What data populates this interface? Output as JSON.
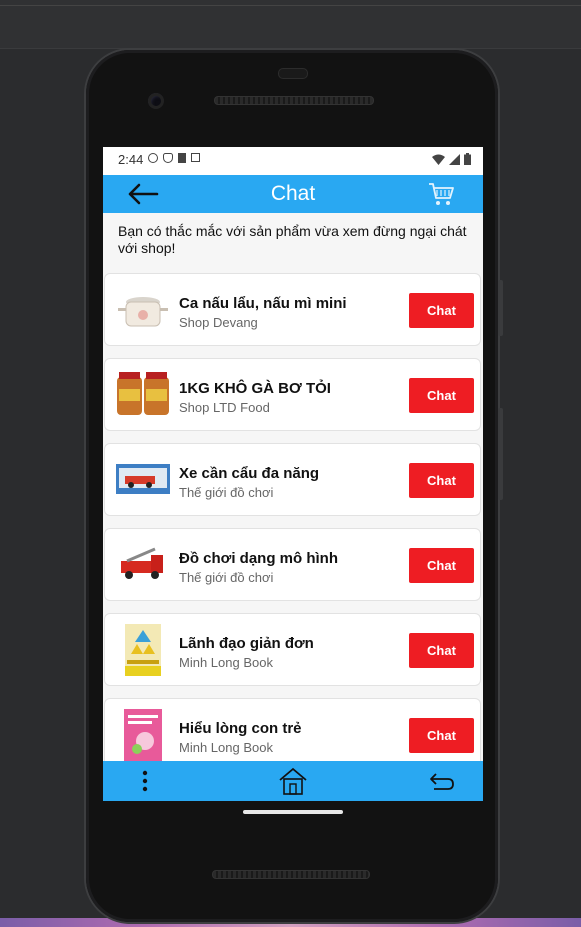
{
  "status": {
    "time": "2:44"
  },
  "appbar": {
    "title": "Chat",
    "back_icon": "arrow-left-icon",
    "cart_icon": "cart-icon"
  },
  "intro": "Bạn có thắc mắc với sản phẩm vừa xem đừng ngại chát với shop!",
  "products": [
    {
      "name": "Ca nấu lẩu, nấu mì mini",
      "shop": "Shop Devang",
      "button": "Chat"
    },
    {
      "name": "1KG KHÔ GÀ BƠ TỎI",
      "shop": "Shop LTD Food",
      "button": "Chat"
    },
    {
      "name": "Xe cần cẩu đa năng",
      "shop": "Thế giới đồ chơi",
      "button": "Chat"
    },
    {
      "name": "Đồ chơi dạng mô hình",
      "shop": "Thế giới đồ chơi",
      "button": "Chat"
    },
    {
      "name": "Lãnh đạo giản đơn",
      "shop": "Minh Long Book",
      "button": "Chat"
    },
    {
      "name": "Hiểu lòng con trẻ",
      "shop": "Minh Long Book",
      "button": "Chat"
    }
  ],
  "navbar": {
    "menu_icon": "more-vertical-icon",
    "home_icon": "home-icon",
    "back_icon": "return-icon"
  },
  "colors": {
    "accent": "#29a8f2",
    "chat_button": "#ee1d23"
  }
}
